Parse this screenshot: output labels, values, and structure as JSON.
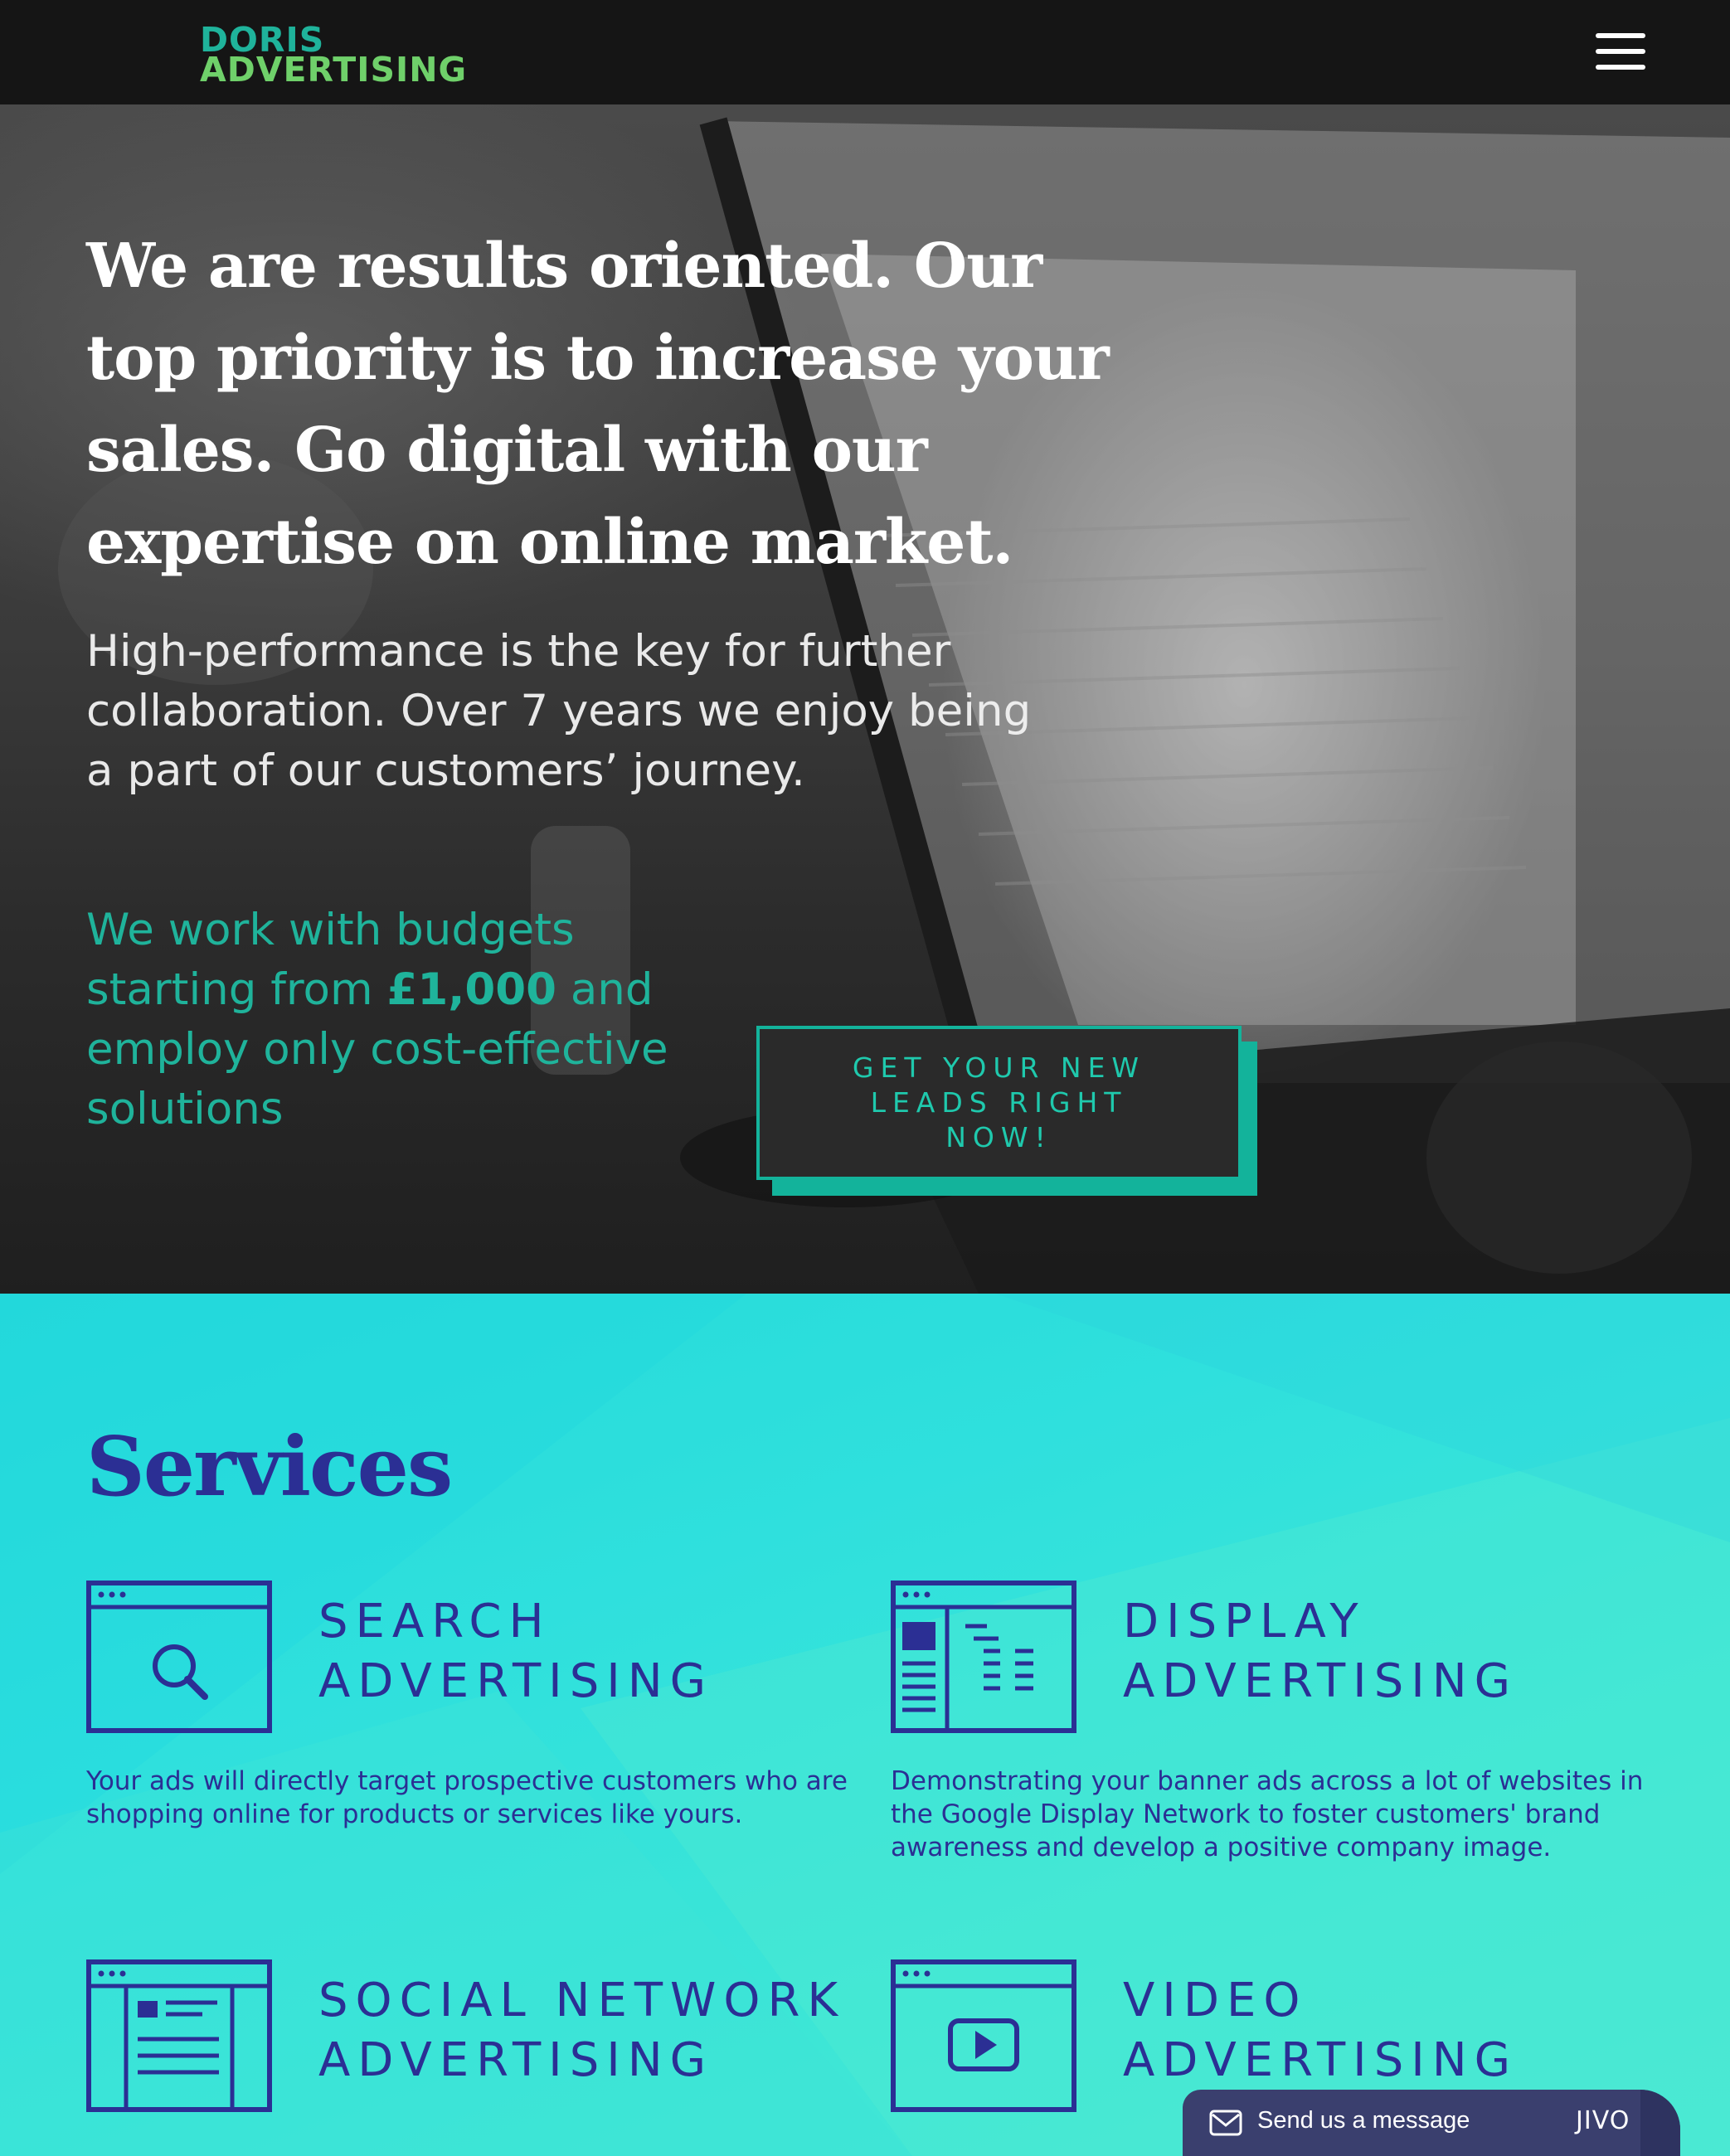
{
  "header": {
    "logo_line1": "DORIS",
    "logo_line2": "ADVERTISING",
    "menu_icon": "hamburger-menu-icon"
  },
  "hero": {
    "headline": "We are results oriented. Our top priority is to increase your sales. Go digital with our expertise on online market.",
    "subtext": "High-performance is the key for further collaboration. Over 7 years we enjoy being a part of our customers’ journey.",
    "budget_pre": "We work with budgets starting from ",
    "budget_amount": "£1,000",
    "budget_post": " and employ only cost-effective solutions",
    "cta_label": "GET YOUR NEW LEADS RIGHT NOW!"
  },
  "services": {
    "title": "Services",
    "items": [
      {
        "title": "SEARCH ADVERTISING",
        "description": "Your ads will directly target prospective customers who are shopping online for products or services like yours.",
        "icon": "search-window-icon"
      },
      {
        "title": "DISPLAY ADVERTISING",
        "description": "Demonstrating your banner ads across a lot of websites in the Google Display Network to foster customers' brand awareness and develop a positive company image.",
        "icon": "display-layout-icon"
      },
      {
        "title": "SOCIAL NETWORK ADVERTISING",
        "description": "",
        "icon": "social-feed-icon"
      },
      {
        "title": "VIDEO ADVERTISING",
        "description": "",
        "icon": "video-play-icon"
      }
    ]
  },
  "chat": {
    "label": "Send us a message",
    "brand": "JIVO",
    "icon": "envelope-icon"
  },
  "colors": {
    "accent_teal": "#1fb39b",
    "logo_green": "#6fd06a",
    "services_text": "#2b2f94",
    "services_bg": "#2fe0dd",
    "chat_bg": "#3a3f6e"
  }
}
